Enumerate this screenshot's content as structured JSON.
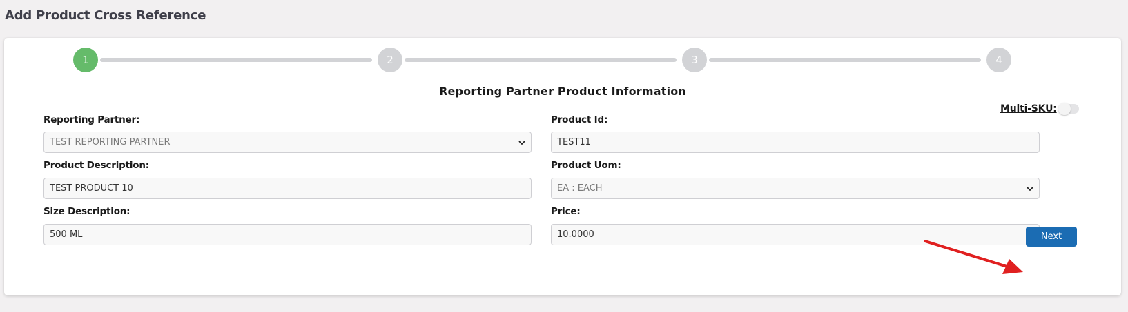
{
  "page_title": "Add Product Cross Reference",
  "stepper": {
    "steps": [
      "1",
      "2",
      "3",
      "4"
    ],
    "active_step": 1
  },
  "section_title": "Reporting Partner Product Information",
  "multi_sku": {
    "label": "Multi-SKU:",
    "enabled": false
  },
  "form": {
    "reporting_partner": {
      "label": "Reporting Partner:",
      "value": "TEST REPORTING PARTNER"
    },
    "product_id": {
      "label": "Product Id:",
      "value": "TEST11"
    },
    "product_description": {
      "label": "Product Description:",
      "value": "TEST PRODUCT 10"
    },
    "product_uom": {
      "label": "Product Uom:",
      "value": "EA : EACH"
    },
    "size_description": {
      "label": "Size Description:",
      "value": "500 ML"
    },
    "price": {
      "label": "Price:",
      "value": "10.0000"
    }
  },
  "next_button": {
    "label": "Next"
  },
  "colors": {
    "active_step": "#65bb6a",
    "inactive_step": "#d2d3d6",
    "primary_button": "#1b6cb3",
    "annotation_arrow": "#e02020"
  },
  "icons": {
    "select_chevron": "chevron-down-icon",
    "annotation": "red-arrow-icon"
  }
}
